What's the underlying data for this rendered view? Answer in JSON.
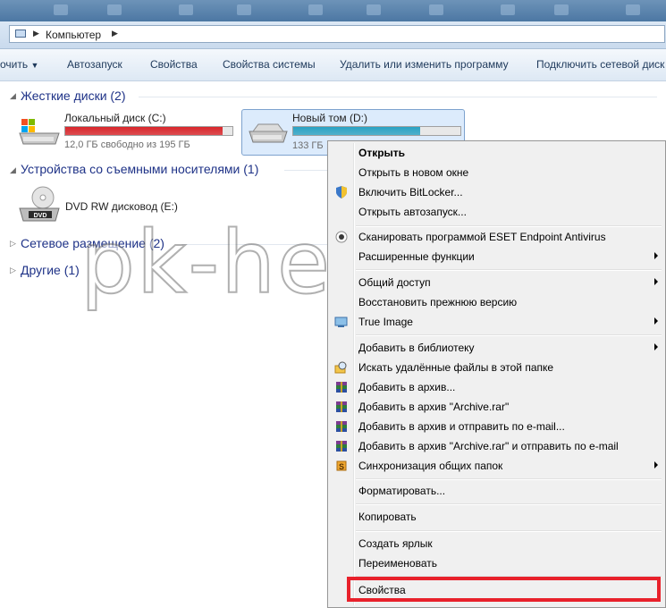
{
  "address": {
    "path": "Компьютер"
  },
  "toolbar": {
    "items": [
      "очить",
      "Автозапуск",
      "Свойства",
      "Свойства системы",
      "Удалить или изменить программу",
      "Подключить сетевой диск"
    ]
  },
  "groups": {
    "hard_disks": "Жесткие диски (2)",
    "removable": "Устройства со съемными носителями (1)",
    "network": "Сетевое размещение (2)",
    "other": "Другие (1)"
  },
  "drives": {
    "c": {
      "name": "Локальный диск (C:)",
      "free": "12,0 ГБ свободно из 195 ГБ",
      "fill": 0.94,
      "color": "#d9262b"
    },
    "d": {
      "name": "Новый том (D:)",
      "free": "133 ГБ",
      "fill": 0.76,
      "color": "#2aa2c4"
    },
    "e": {
      "name": "DVD RW дисковод (E:)"
    }
  },
  "watermark": "pk-help.com",
  "menu": {
    "items": [
      {
        "label": "Открыть",
        "bold": true
      },
      {
        "label": "Открыть в новом окне"
      },
      {
        "label": "Включить BitLocker...",
        "icon": "shield-icon"
      },
      {
        "label": "Открыть автозапуск..."
      },
      {
        "label": "Сканировать программой ESET Endpoint Antivirus",
        "icon": "eset-icon"
      },
      {
        "label": "Расширенные функции",
        "submenu": true
      },
      {
        "label": "Общий доступ",
        "submenu": true
      },
      {
        "label": "Восстановить прежнюю версию"
      },
      {
        "label": "True Image",
        "icon": "true-image-icon",
        "submenu": true
      },
      {
        "label": "Добавить в библиотеку",
        "submenu": true
      },
      {
        "label": "Искать удалённые файлы в этой папке",
        "icon": "search-deleted-icon"
      },
      {
        "label": "Добавить в архив...",
        "icon": "winrar-icon"
      },
      {
        "label": "Добавить в архив \"Archive.rar\"",
        "icon": "winrar-icon"
      },
      {
        "label": "Добавить в архив и отправить по e-mail...",
        "icon": "winrar-icon"
      },
      {
        "label": "Добавить в архив \"Archive.rar\" и отправить по e-mail",
        "icon": "winrar-icon"
      },
      {
        "label": "Синхронизация общих папок",
        "icon": "sync-icon",
        "submenu": true
      },
      {
        "label": "Форматировать..."
      },
      {
        "label": "Копировать"
      },
      {
        "label": "Создать ярлык"
      },
      {
        "label": "Переименовать"
      },
      {
        "label": "Свойства"
      }
    ]
  },
  "colors": {
    "highlight": "#e8212b"
  }
}
